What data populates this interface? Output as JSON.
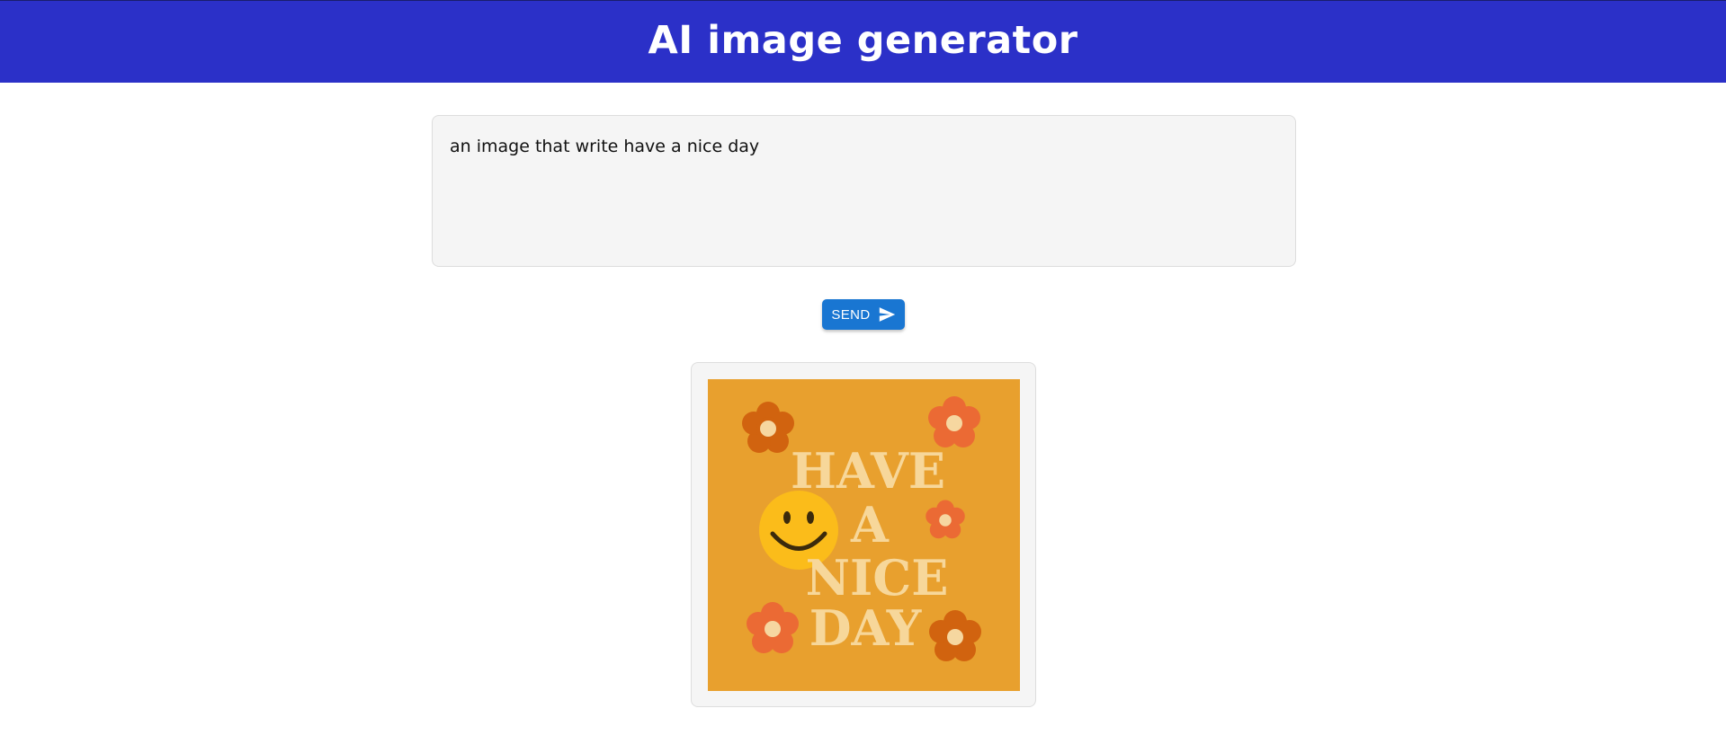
{
  "header": {
    "title": "AI image generator"
  },
  "prompt": {
    "value": "an image that write have a nice day"
  },
  "send_button": {
    "label": "SEND",
    "icon": "send-icon"
  },
  "result": {
    "image_text": [
      "HAVE",
      "A",
      "NICE",
      "DAY"
    ],
    "colors": {
      "background": "#e8a02e",
      "text": "#f7d79a",
      "smiley": "#fbbc1a",
      "flower_dark": "#d1630f",
      "flower_light": "#eb6a34",
      "flower_center": "#f6d7a0"
    }
  },
  "colors": {
    "header_bg": "#2b30c8",
    "button_bg": "#1976d2",
    "input_bg": "#f5f5f5"
  }
}
